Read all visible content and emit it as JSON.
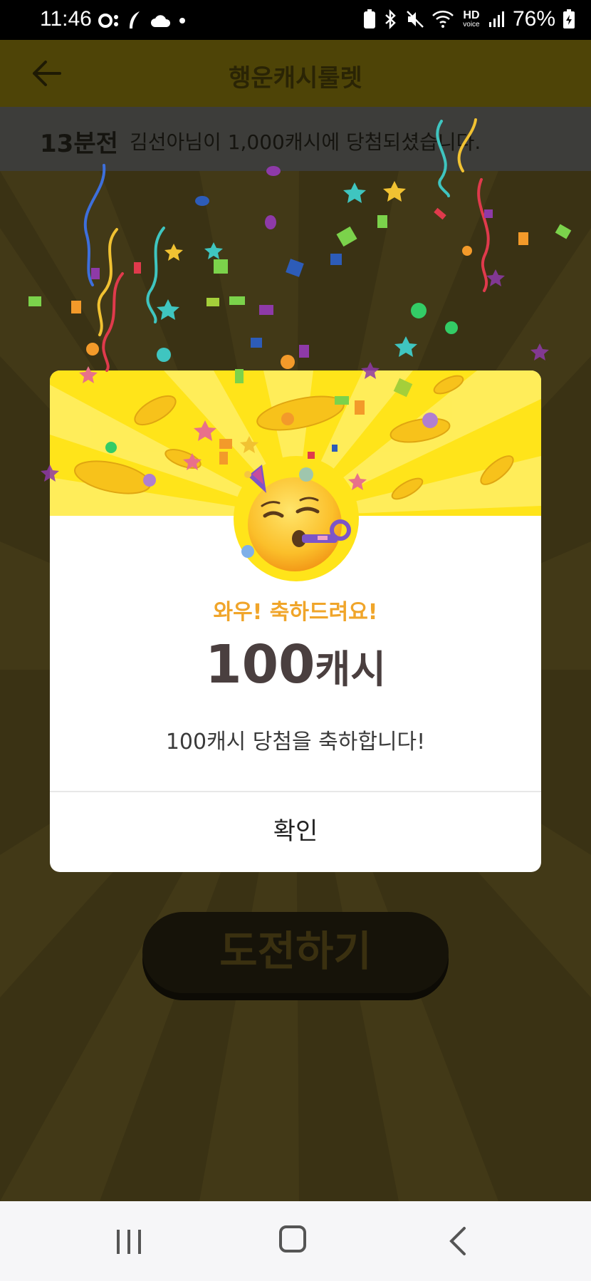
{
  "status_bar": {
    "time": "11:46",
    "battery": "76%",
    "hd_label": "HD",
    "voice_label": "voice"
  },
  "app_bar": {
    "title": "행운캐시룰렛"
  },
  "ticker": {
    "time_ago": "13분전",
    "message": "김선아님이 1,000캐시에 당첨되셨습니다.",
    "chip_value": "1000"
  },
  "main": {
    "challenge_label": "도전하기"
  },
  "dialog": {
    "headline": "와우! 축하드려요!",
    "amount": "100",
    "amount_unit": "캐시",
    "description": "100캐시 당첨을 축하합니다!",
    "confirm_label": "확인"
  },
  "colors": {
    "accent_yellow": "#ffe41a",
    "headline_orange": "#f0a52a",
    "amount_text": "#4a3f3f"
  }
}
